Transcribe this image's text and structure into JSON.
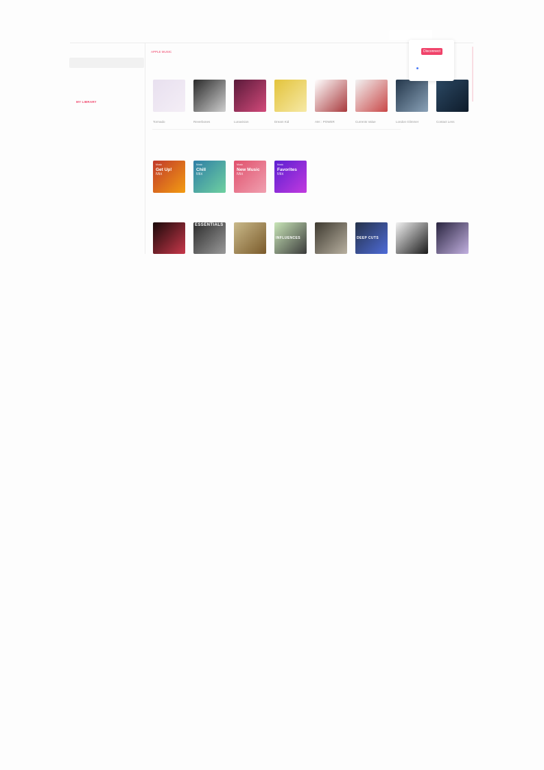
{
  "sidebar": {
    "library_label": "MY LIBRARY"
  },
  "main": {
    "section_label": "APPLE MUSIC",
    "albums": [
      {
        "name": "Tormado",
        "colors": [
          "#e8e0ef",
          "#f4eef6"
        ]
      },
      {
        "name": "Reverbones",
        "colors": [
          "#2a2a2a",
          "#cfcfcf"
        ]
      },
      {
        "name": "Lunavision",
        "colors": [
          "#5a1a3a",
          "#d24a7a"
        ]
      },
      {
        "name": "Dream Kid",
        "colors": [
          "#e3c33b",
          "#f6e9a6"
        ]
      },
      {
        "name": "AM :: POWER",
        "colors": [
          "#ffffff",
          "#a8393c"
        ]
      },
      {
        "name": "Currents Value",
        "colors": [
          "#f2f2f2",
          "#c94747"
        ]
      },
      {
        "name": "London Glimmer",
        "colors": [
          "#24374b",
          "#8aa2b8"
        ]
      },
      {
        "name": "Contact Lens",
        "colors": [
          "#2b4863",
          "#0e1b2a"
        ]
      }
    ],
    "mixes": [
      {
        "brand": "Music",
        "title": "Get Up!",
        "sub": "Mix",
        "colors": [
          "#c0392b",
          "#f39c12"
        ]
      },
      {
        "brand": "Music",
        "title": "Chill",
        "sub": "Mix",
        "colors": [
          "#2e7ea6",
          "#6fd1a0"
        ]
      },
      {
        "brand": "Music",
        "title": "New Music",
        "sub": "Mix",
        "colors": [
          "#e0506c",
          "#f0a0b0"
        ]
      },
      {
        "brand": "Music",
        "title": "Favorites",
        "sub": "Mix",
        "colors": [
          "#5b1fd1",
          "#c23adf"
        ]
      }
    ],
    "recommended": [
      {
        "label": "",
        "colors": [
          "#1a0a0a",
          "#c8374a"
        ]
      },
      {
        "label": "ESSENTIALS",
        "colors": [
          "#2c2c2c",
          "#9a9a9a"
        ]
      },
      {
        "label": "",
        "colors": [
          "#c9b98a",
          "#7a5a2a"
        ]
      },
      {
        "label": "INFLUENCES",
        "colors": [
          "#c9e6b8",
          "#3a3a3a"
        ]
      },
      {
        "label": "",
        "colors": [
          "#3e3a30",
          "#b8b0a0"
        ]
      },
      {
        "label": "DEEP CUTS",
        "colors": [
          "#25324a",
          "#4e6bd8"
        ]
      },
      {
        "label": "",
        "colors": [
          "#f2f2f2",
          "#1a1a1a"
        ]
      },
      {
        "label": "",
        "colors": [
          "#2a2540",
          "#c2b0e0"
        ]
      }
    ]
  },
  "popup": {
    "disconnect_label": "Disconnect"
  },
  "colors": {
    "accent": "#f0436a"
  }
}
